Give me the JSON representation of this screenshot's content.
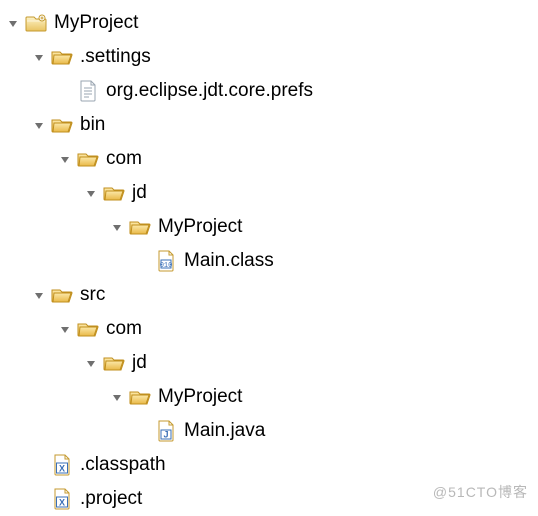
{
  "tree": {
    "root": {
      "label": "MyProject",
      "expanded": true,
      "icon": "project-folder"
    },
    "settings": {
      "label": ".settings",
      "expanded": true,
      "icon": "folder"
    },
    "prefs": {
      "label": "org.eclipse.jdt.core.prefs",
      "icon": "text-file"
    },
    "bin": {
      "label": "bin",
      "expanded": true,
      "icon": "folder"
    },
    "bin_com": {
      "label": "com",
      "expanded": true,
      "icon": "folder"
    },
    "bin_jd": {
      "label": "jd",
      "expanded": true,
      "icon": "folder"
    },
    "bin_myproject": {
      "label": "MyProject",
      "expanded": true,
      "icon": "folder"
    },
    "main_class": {
      "label": "Main.class",
      "icon": "class-file"
    },
    "src": {
      "label": "src",
      "expanded": true,
      "icon": "folder"
    },
    "src_com": {
      "label": "com",
      "expanded": true,
      "icon": "folder"
    },
    "src_jd": {
      "label": "jd",
      "expanded": true,
      "icon": "folder"
    },
    "src_myproject": {
      "label": "MyProject",
      "expanded": true,
      "icon": "folder"
    },
    "main_java": {
      "label": "Main.java",
      "icon": "java-file"
    },
    "classpath": {
      "label": ".classpath",
      "icon": "xml-file"
    },
    "project": {
      "label": ".project",
      "icon": "xml-file"
    }
  },
  "watermark": "@51CTO博客"
}
